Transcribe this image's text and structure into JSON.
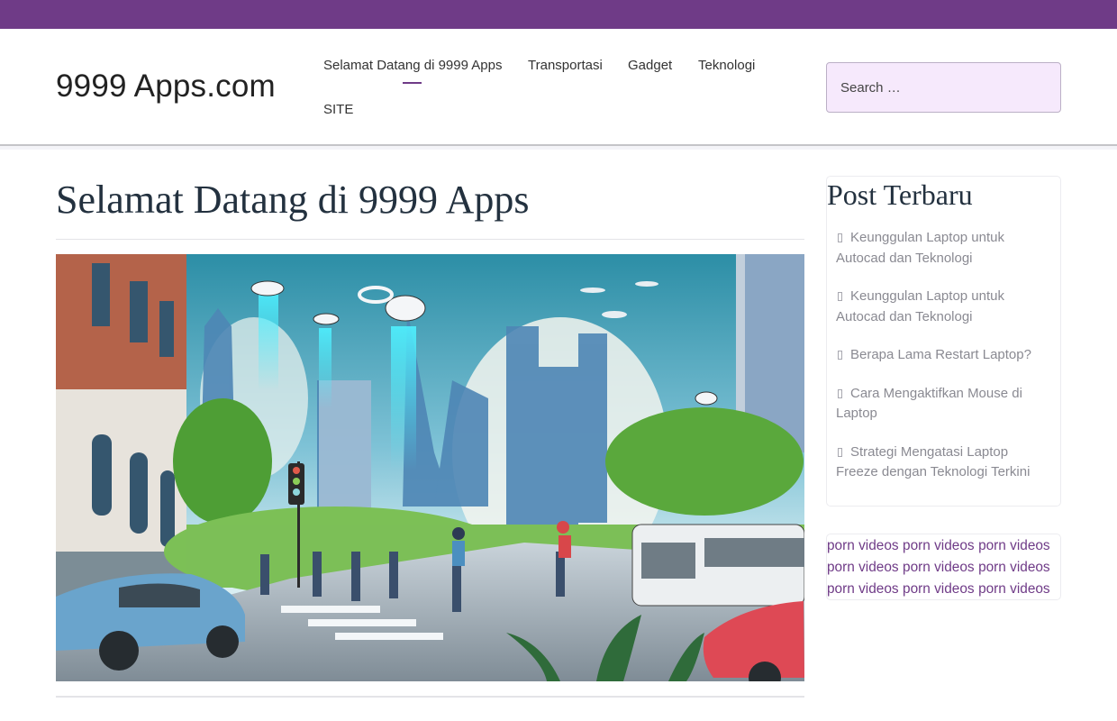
{
  "theme": {
    "accent": "#6f3b87",
    "search_bg": "#f6e9fc"
  },
  "header": {
    "site_title": "9999 Apps.com",
    "nav": [
      {
        "label": "Selamat Datang di 9999 Apps",
        "active": true
      },
      {
        "label": "Transportasi",
        "active": false
      },
      {
        "label": "Gadget",
        "active": false
      },
      {
        "label": "Teknologi",
        "active": false
      },
      {
        "label": "SITE",
        "active": false
      }
    ],
    "search": {
      "placeholder": "Search …",
      "value": ""
    }
  },
  "main": {
    "title": "Selamat Datang di 9999 Apps",
    "hero_image": {
      "alt": "Futuristic city street with drones, electric scooters, an electric bus and cars",
      "icon": "image-icon"
    }
  },
  "sidebar": {
    "recent_posts": {
      "title": "Post Terbaru",
      "bullet_icon": "missing-glyph-icon",
      "items": [
        {
          "label": "Keunggulan Laptop untuk Autocad dan Teknologi"
        },
        {
          "label": "Keunggulan Laptop untuk Autocad dan Teknologi"
        },
        {
          "label": "Berapa Lama Restart Laptop?"
        },
        {
          "label": "Cara Mengaktifkan Mouse di Laptop"
        },
        {
          "label": "Strategi Mengatasi Laptop Freeze dengan Teknologi Terkini"
        }
      ]
    },
    "links_widget": {
      "lines": [
        [
          "porn videos",
          "porn videos",
          "porn videos"
        ],
        [
          "porn videos",
          "porn videos",
          "porn videos"
        ],
        [
          "porn videos",
          "porn videos",
          "porn videos"
        ]
      ]
    }
  }
}
